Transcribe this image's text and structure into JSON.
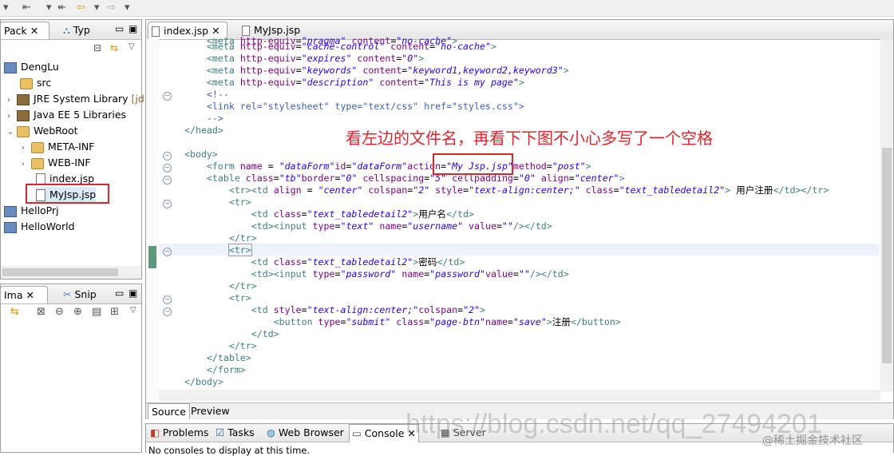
{
  "toolbar": {
    "icons": [
      "back-icon",
      "forward-icon",
      "dropdown-icon",
      "nav-icon"
    ]
  },
  "package_explorer": {
    "tabs": [
      {
        "label": "Pack"
      },
      {
        "label": "Typ"
      }
    ],
    "tree": [
      {
        "label": "DengLu",
        "icon": "project"
      },
      {
        "label": "src",
        "icon": "package"
      },
      {
        "label": "JRE System Library",
        "extra": "[jdk"
      },
      {
        "label": "Java EE 5 Libraries"
      },
      {
        "label": "WebRoot"
      },
      {
        "label": "META-INF"
      },
      {
        "label": "WEB-INF"
      },
      {
        "label": "index.jsp"
      },
      {
        "label": "MyJsp.jsp"
      },
      {
        "label": "HelloPrj"
      },
      {
        "label": "HelloWorld"
      }
    ]
  },
  "image_panel": {
    "tabs": [
      {
        "label": "Ima"
      },
      {
        "label": "Snip"
      }
    ]
  },
  "editor": {
    "tabs": [
      {
        "label": "index.jsp"
      },
      {
        "label": "MyJsp.jsp"
      }
    ],
    "bottom_tabs": [
      {
        "label": "Source"
      },
      {
        "label": "Preview"
      }
    ],
    "annotation": "看左边的文件名，再看下下图不小心多写了一个空格"
  },
  "console": {
    "tabs": [
      {
        "label": "Problems"
      },
      {
        "label": "Tasks"
      },
      {
        "label": "Web Browser"
      },
      {
        "label": "Console"
      },
      {
        "label": "Server"
      }
    ],
    "message": "No consoles to display at this time."
  },
  "watermark": "https://blog.csdn.net/qq_27494201",
  "watermark2": "@稀土掘金技术社区"
}
